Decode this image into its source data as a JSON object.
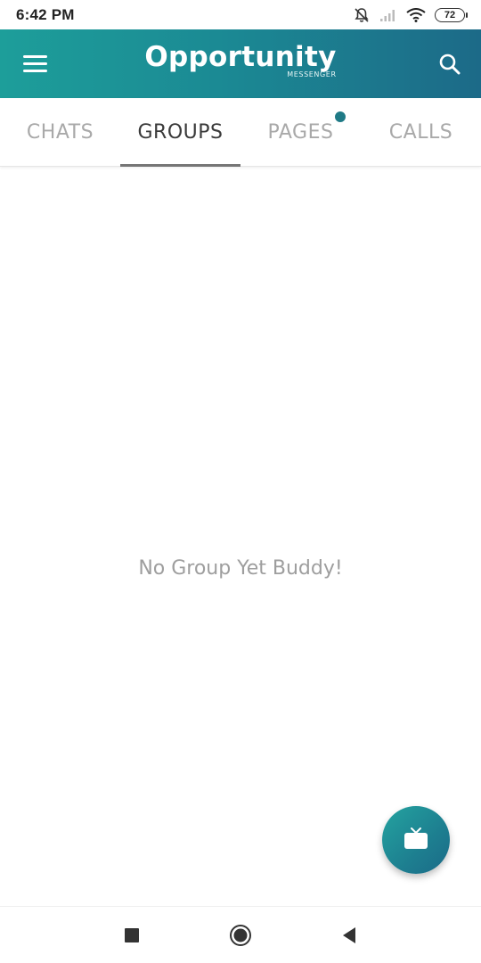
{
  "status_bar": {
    "time": "6:42 PM",
    "battery": "72",
    "icons": [
      "bell-off-icon",
      "signal-icon",
      "wifi-icon",
      "battery-icon"
    ]
  },
  "app_bar": {
    "title": "Opportunity",
    "subtitle": "MESSENGER",
    "icons": [
      "menu-icon",
      "search-icon"
    ]
  },
  "tabs": [
    {
      "label": "CHATS",
      "active": false
    },
    {
      "label": "GROUPS",
      "active": true
    },
    {
      "label": "PAGES",
      "active": false,
      "badge": true
    },
    {
      "label": "CALLS",
      "active": false
    }
  ],
  "main": {
    "empty_message": "No Group Yet Buddy!"
  },
  "fab": {
    "icon": "tv-icon"
  },
  "nav_bar": {
    "icons": [
      "square-nav-icon",
      "home-circle-icon",
      "back-triangle-icon"
    ]
  },
  "colors": {
    "brand_start": "#1d9e9a",
    "brand_end": "#1c6a88",
    "badge": "#1f7a86",
    "tab_active": "#3a3a3a",
    "tab_inactive": "#a9a9a9"
  }
}
